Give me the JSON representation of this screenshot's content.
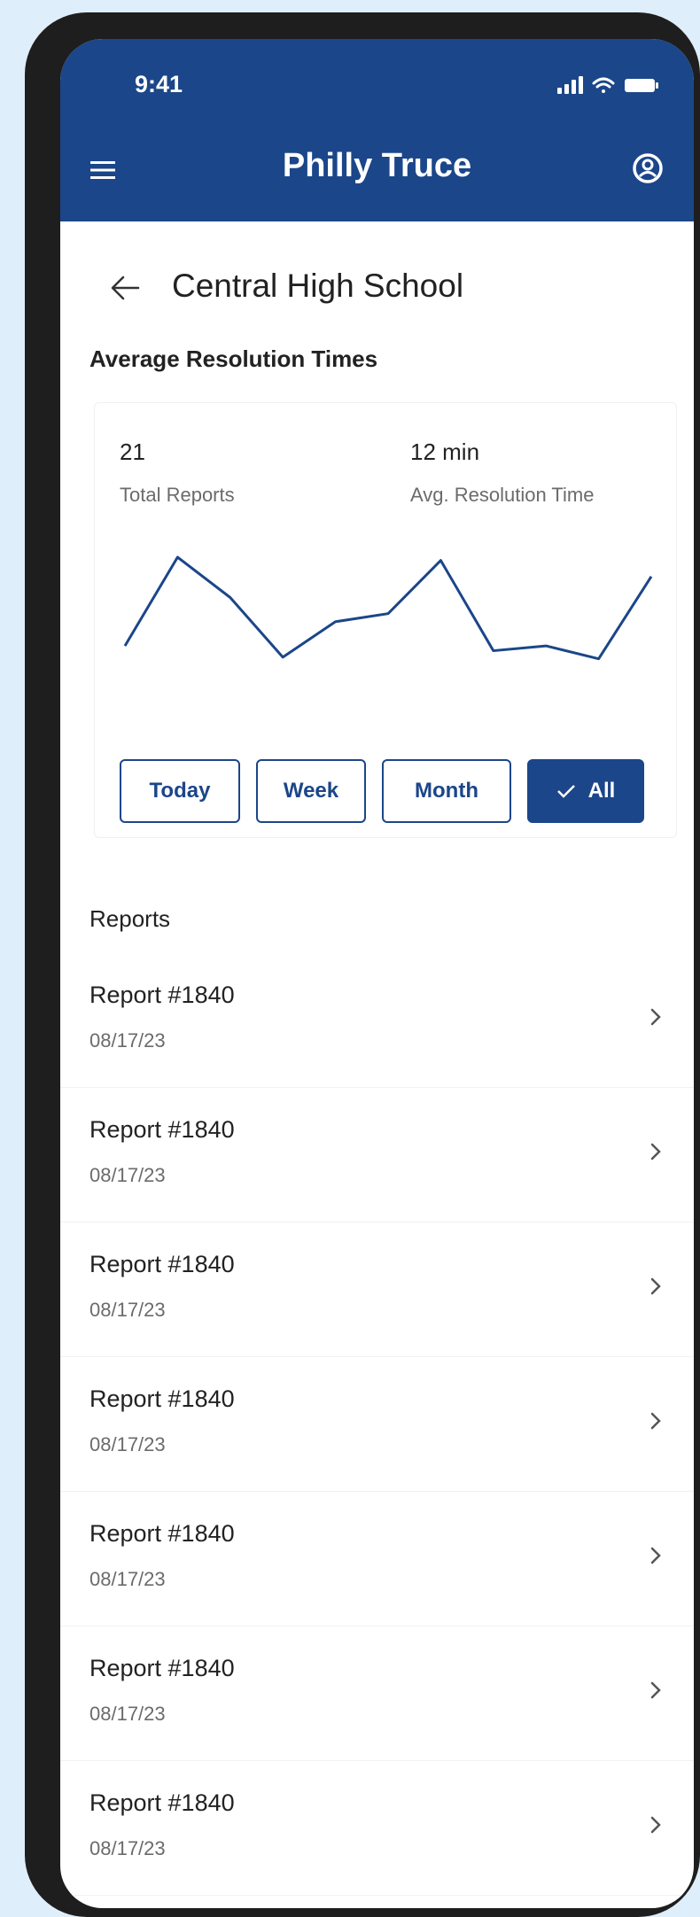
{
  "status_bar": {
    "time": "9:41"
  },
  "app_bar": {
    "title": "Philly Truce"
  },
  "page": {
    "title": "Central High School"
  },
  "summary": {
    "heading": "Average Resolution Times",
    "total_reports_value": "21",
    "total_reports_label": "Total Reports",
    "avg_resolution_value": "12 min",
    "avg_resolution_label": "Avg. Resolution Time"
  },
  "chart_data": {
    "type": "line",
    "values": [
      0.45,
      1.0,
      0.75,
      0.38,
      0.6,
      0.65,
      0.98,
      0.42,
      0.45,
      0.37,
      0.88
    ]
  },
  "filters": [
    {
      "label": "Today",
      "selected": false
    },
    {
      "label": "Week",
      "selected": false
    },
    {
      "label": "Month",
      "selected": false
    },
    {
      "label": "All",
      "selected": true
    }
  ],
  "reports": {
    "heading": "Reports",
    "items": [
      {
        "name": "Report #1840",
        "date": "08/17/23"
      },
      {
        "name": "Report #1840",
        "date": "08/17/23"
      },
      {
        "name": "Report #1840",
        "date": "08/17/23"
      },
      {
        "name": "Report #1840",
        "date": "08/17/23"
      },
      {
        "name": "Report #1840",
        "date": "08/17/23"
      },
      {
        "name": "Report #1840",
        "date": "08/17/23"
      },
      {
        "name": "Report #1840",
        "date": "08/17/23"
      }
    ]
  },
  "colors": {
    "primary": "#1b4689",
    "background": "#dfeefb"
  }
}
